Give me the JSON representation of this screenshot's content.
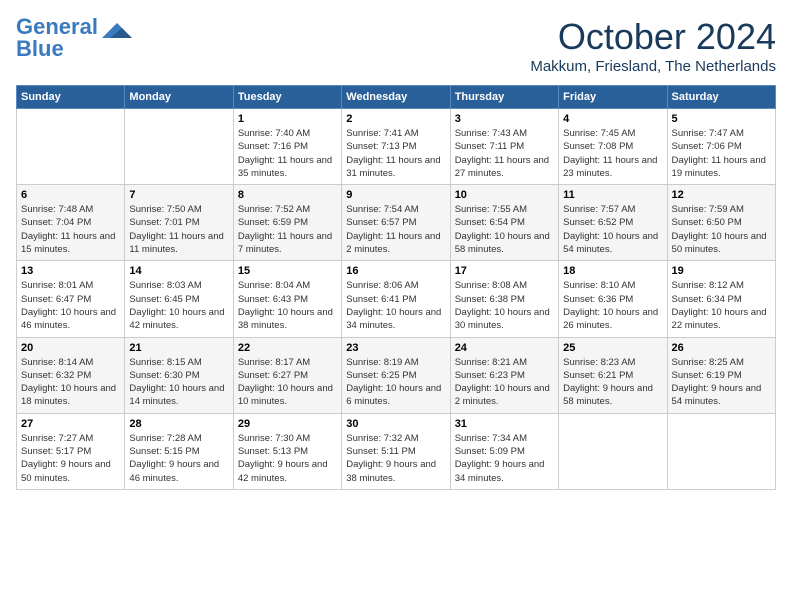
{
  "logo": {
    "line1": "General",
    "line2": "Blue"
  },
  "title": "October 2024",
  "location": "Makkum, Friesland, The Netherlands",
  "weekdays": [
    "Sunday",
    "Monday",
    "Tuesday",
    "Wednesday",
    "Thursday",
    "Friday",
    "Saturday"
  ],
  "weeks": [
    [
      {
        "day": "",
        "sunrise": "",
        "sunset": "",
        "daylight": ""
      },
      {
        "day": "",
        "sunrise": "",
        "sunset": "",
        "daylight": ""
      },
      {
        "day": "1",
        "sunrise": "Sunrise: 7:40 AM",
        "sunset": "Sunset: 7:16 PM",
        "daylight": "Daylight: 11 hours and 35 minutes."
      },
      {
        "day": "2",
        "sunrise": "Sunrise: 7:41 AM",
        "sunset": "Sunset: 7:13 PM",
        "daylight": "Daylight: 11 hours and 31 minutes."
      },
      {
        "day": "3",
        "sunrise": "Sunrise: 7:43 AM",
        "sunset": "Sunset: 7:11 PM",
        "daylight": "Daylight: 11 hours and 27 minutes."
      },
      {
        "day": "4",
        "sunrise": "Sunrise: 7:45 AM",
        "sunset": "Sunset: 7:08 PM",
        "daylight": "Daylight: 11 hours and 23 minutes."
      },
      {
        "day": "5",
        "sunrise": "Sunrise: 7:47 AM",
        "sunset": "Sunset: 7:06 PM",
        "daylight": "Daylight: 11 hours and 19 minutes."
      }
    ],
    [
      {
        "day": "6",
        "sunrise": "Sunrise: 7:48 AM",
        "sunset": "Sunset: 7:04 PM",
        "daylight": "Daylight: 11 hours and 15 minutes."
      },
      {
        "day": "7",
        "sunrise": "Sunrise: 7:50 AM",
        "sunset": "Sunset: 7:01 PM",
        "daylight": "Daylight: 11 hours and 11 minutes."
      },
      {
        "day": "8",
        "sunrise": "Sunrise: 7:52 AM",
        "sunset": "Sunset: 6:59 PM",
        "daylight": "Daylight: 11 hours and 7 minutes."
      },
      {
        "day": "9",
        "sunrise": "Sunrise: 7:54 AM",
        "sunset": "Sunset: 6:57 PM",
        "daylight": "Daylight: 11 hours and 2 minutes."
      },
      {
        "day": "10",
        "sunrise": "Sunrise: 7:55 AM",
        "sunset": "Sunset: 6:54 PM",
        "daylight": "Daylight: 10 hours and 58 minutes."
      },
      {
        "day": "11",
        "sunrise": "Sunrise: 7:57 AM",
        "sunset": "Sunset: 6:52 PM",
        "daylight": "Daylight: 10 hours and 54 minutes."
      },
      {
        "day": "12",
        "sunrise": "Sunrise: 7:59 AM",
        "sunset": "Sunset: 6:50 PM",
        "daylight": "Daylight: 10 hours and 50 minutes."
      }
    ],
    [
      {
        "day": "13",
        "sunrise": "Sunrise: 8:01 AM",
        "sunset": "Sunset: 6:47 PM",
        "daylight": "Daylight: 10 hours and 46 minutes."
      },
      {
        "day": "14",
        "sunrise": "Sunrise: 8:03 AM",
        "sunset": "Sunset: 6:45 PM",
        "daylight": "Daylight: 10 hours and 42 minutes."
      },
      {
        "day": "15",
        "sunrise": "Sunrise: 8:04 AM",
        "sunset": "Sunset: 6:43 PM",
        "daylight": "Daylight: 10 hours and 38 minutes."
      },
      {
        "day": "16",
        "sunrise": "Sunrise: 8:06 AM",
        "sunset": "Sunset: 6:41 PM",
        "daylight": "Daylight: 10 hours and 34 minutes."
      },
      {
        "day": "17",
        "sunrise": "Sunrise: 8:08 AM",
        "sunset": "Sunset: 6:38 PM",
        "daylight": "Daylight: 10 hours and 30 minutes."
      },
      {
        "day": "18",
        "sunrise": "Sunrise: 8:10 AM",
        "sunset": "Sunset: 6:36 PM",
        "daylight": "Daylight: 10 hours and 26 minutes."
      },
      {
        "day": "19",
        "sunrise": "Sunrise: 8:12 AM",
        "sunset": "Sunset: 6:34 PM",
        "daylight": "Daylight: 10 hours and 22 minutes."
      }
    ],
    [
      {
        "day": "20",
        "sunrise": "Sunrise: 8:14 AM",
        "sunset": "Sunset: 6:32 PM",
        "daylight": "Daylight: 10 hours and 18 minutes."
      },
      {
        "day": "21",
        "sunrise": "Sunrise: 8:15 AM",
        "sunset": "Sunset: 6:30 PM",
        "daylight": "Daylight: 10 hours and 14 minutes."
      },
      {
        "day": "22",
        "sunrise": "Sunrise: 8:17 AM",
        "sunset": "Sunset: 6:27 PM",
        "daylight": "Daylight: 10 hours and 10 minutes."
      },
      {
        "day": "23",
        "sunrise": "Sunrise: 8:19 AM",
        "sunset": "Sunset: 6:25 PM",
        "daylight": "Daylight: 10 hours and 6 minutes."
      },
      {
        "day": "24",
        "sunrise": "Sunrise: 8:21 AM",
        "sunset": "Sunset: 6:23 PM",
        "daylight": "Daylight: 10 hours and 2 minutes."
      },
      {
        "day": "25",
        "sunrise": "Sunrise: 8:23 AM",
        "sunset": "Sunset: 6:21 PM",
        "daylight": "Daylight: 9 hours and 58 minutes."
      },
      {
        "day": "26",
        "sunrise": "Sunrise: 8:25 AM",
        "sunset": "Sunset: 6:19 PM",
        "daylight": "Daylight: 9 hours and 54 minutes."
      }
    ],
    [
      {
        "day": "27",
        "sunrise": "Sunrise: 7:27 AM",
        "sunset": "Sunset: 5:17 PM",
        "daylight": "Daylight: 9 hours and 50 minutes."
      },
      {
        "day": "28",
        "sunrise": "Sunrise: 7:28 AM",
        "sunset": "Sunset: 5:15 PM",
        "daylight": "Daylight: 9 hours and 46 minutes."
      },
      {
        "day": "29",
        "sunrise": "Sunrise: 7:30 AM",
        "sunset": "Sunset: 5:13 PM",
        "daylight": "Daylight: 9 hours and 42 minutes."
      },
      {
        "day": "30",
        "sunrise": "Sunrise: 7:32 AM",
        "sunset": "Sunset: 5:11 PM",
        "daylight": "Daylight: 9 hours and 38 minutes."
      },
      {
        "day": "31",
        "sunrise": "Sunrise: 7:34 AM",
        "sunset": "Sunset: 5:09 PM",
        "daylight": "Daylight: 9 hours and 34 minutes."
      },
      {
        "day": "",
        "sunrise": "",
        "sunset": "",
        "daylight": ""
      },
      {
        "day": "",
        "sunrise": "",
        "sunset": "",
        "daylight": ""
      }
    ]
  ]
}
